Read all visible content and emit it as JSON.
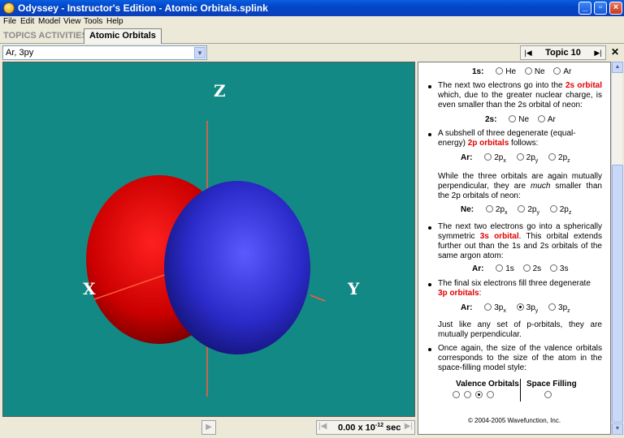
{
  "window": {
    "title": "Odyssey - Instructor's Edition - Atomic Orbitals.splink"
  },
  "menu": [
    "File",
    "Edit",
    "Model",
    "View",
    "Tools",
    "Help"
  ],
  "tabs": {
    "topics_activities": "TOPICS ACTIVITIES",
    "active": "Atomic Orbitals"
  },
  "model_select": {
    "value": "Ar, 3py"
  },
  "topic_nav": {
    "label": "Topic 10"
  },
  "viewer": {
    "axes": {
      "z": "Z",
      "x": "X",
      "y": "Y"
    }
  },
  "time": {
    "value": "0.00 x 10",
    "exp": "-12",
    "unit": " sec"
  },
  "colors": {
    "background": "#138985",
    "lobe_positive": "#cc0000",
    "lobe_negative": "#2525b8"
  },
  "panel": {
    "row_1s": {
      "label": "1s:",
      "options": [
        "He",
        "Ne",
        "Ar"
      ]
    },
    "b1": {
      "pre": "The next two electrons go into the ",
      "hl": "2s orbital",
      "post": " which, due to the greater nuclear charge, is even smaller than the 2s orbital of neon:"
    },
    "row_2s": {
      "label": "2s:",
      "options": [
        "Ne",
        "Ar"
      ]
    },
    "b2": {
      "pre": "A subshell of three degenerate (equal-energy) ",
      "hl": "2p orbitals",
      "post": " follows:"
    },
    "row_2p_ar": {
      "label": "Ar:",
      "base": "2p",
      "subs": [
        "x",
        "y",
        "z"
      ]
    },
    "para_2p": {
      "pre": "While the three orbitals are again mutually perpendicular, they are ",
      "em": "much",
      "post": " smaller than the 2p orbitals of neon:"
    },
    "row_2p_ne": {
      "label": "Ne:",
      "base": "2p",
      "subs": [
        "x",
        "y",
        "z"
      ]
    },
    "b3": {
      "pre": "The next two electrons go into a spherically symmetric ",
      "hl": "3s orbital",
      "post": ". This orbital extends further out than the 1s and 2s orbitals of the same argon atom:"
    },
    "row_3s": {
      "label": "Ar:",
      "options": [
        "1s",
        "2s",
        "3s"
      ]
    },
    "b4": {
      "pre": "The final six electrons fill three degenerate ",
      "hl": "3p orbitals",
      "post": ":"
    },
    "row_3p": {
      "label": "Ar:",
      "base": "3p",
      "subs": [
        "x",
        "y",
        "z"
      ],
      "selected": "y"
    },
    "para_3p": "Just like any set of p-orbitals, they are mutually perpendicular.",
    "b5": "Once again, the size of the valence orbitals corresponds to the size of the atom in the space-filling model style:",
    "valence_head": "Valence Orbitals",
    "space_head": "Space Filling",
    "copyright": "© 2004-2005  Wavefunction, Inc."
  }
}
